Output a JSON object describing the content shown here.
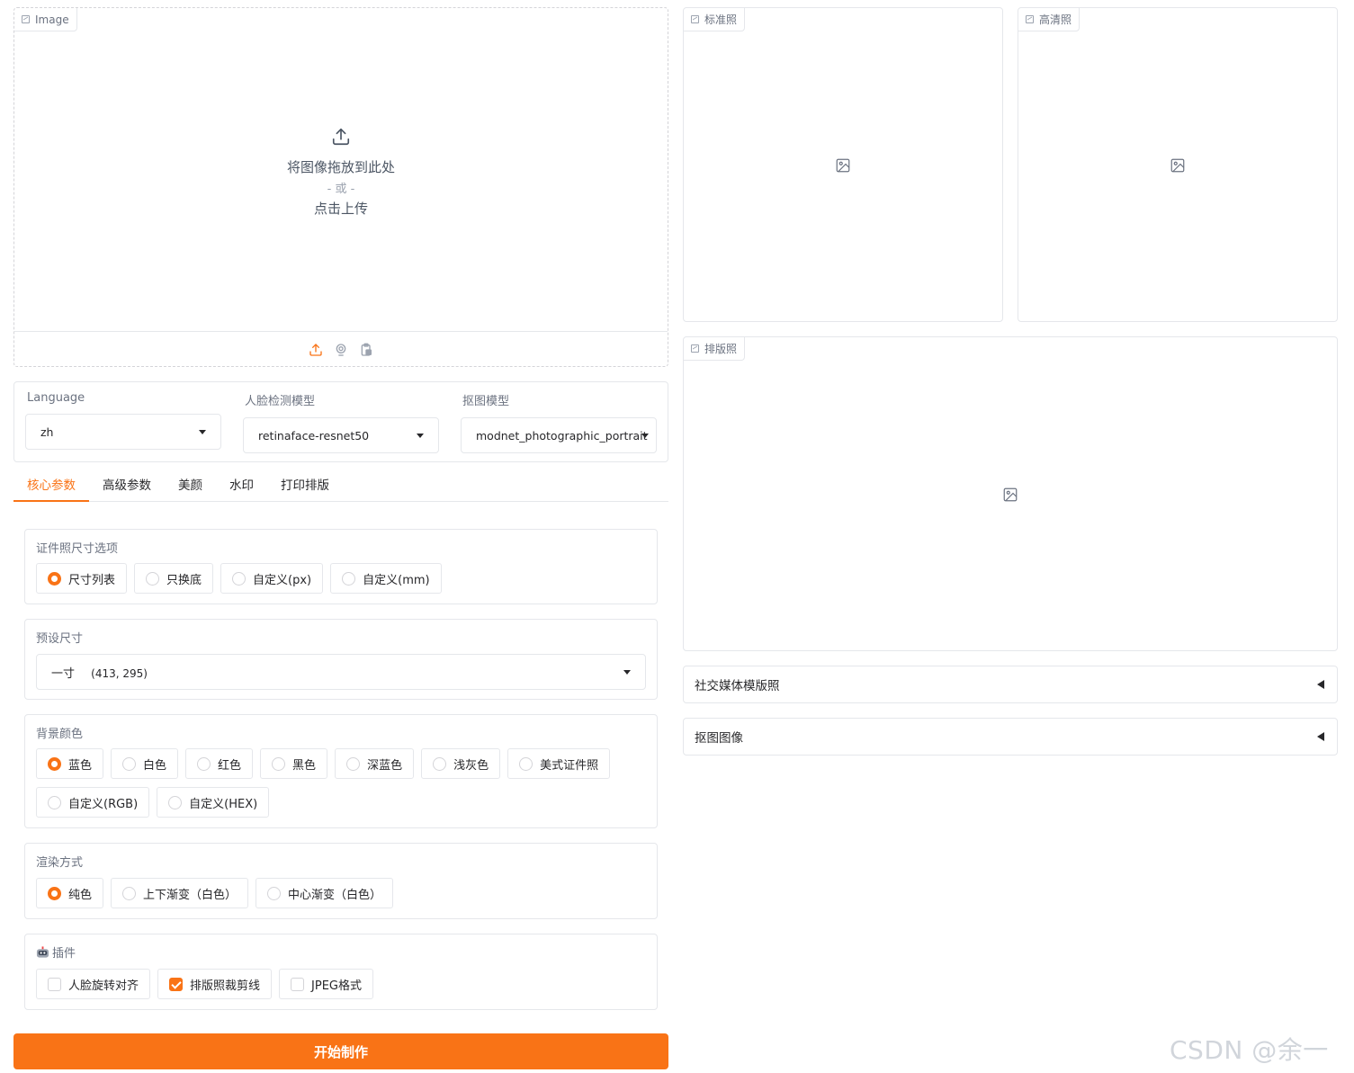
{
  "upload": {
    "tag": "Image",
    "drop_text": "将图像拖放到此处",
    "or_text": "- 或 -",
    "click_text": "点击上传"
  },
  "dropdowns": [
    {
      "label": "Language",
      "value": "zh"
    },
    {
      "label": "人脸检测模型",
      "value": "retinaface-resnet50"
    },
    {
      "label": "抠图模型",
      "value": "modnet_photographic_portrait"
    }
  ],
  "tabs": [
    "核心参数",
    "高级参数",
    "美颜",
    "水印",
    "打印排版"
  ],
  "size_options": {
    "label": "证件照尺寸选项",
    "options": [
      "尺寸列表",
      "只换底",
      "自定义(px)",
      "自定义(mm)"
    ],
    "selected": 0
  },
  "preset": {
    "label": "预设尺寸",
    "value_name": "一寸",
    "value_size": "(413, 295)"
  },
  "bg_color": {
    "label": "背景颜色",
    "options": [
      "蓝色",
      "白色",
      "红色",
      "黑色",
      "深蓝色",
      "浅灰色",
      "美式证件照",
      "自定义(RGB)",
      "自定义(HEX)"
    ],
    "selected": 0
  },
  "render": {
    "label": "渲染方式",
    "options": [
      "纯色",
      "上下渐变（白色）",
      "中心渐变（白色）"
    ],
    "selected": 0
  },
  "plugins": {
    "label": "插件",
    "options": [
      {
        "label": "人脸旋转对齐",
        "checked": false
      },
      {
        "label": "排版照裁剪线",
        "checked": true
      },
      {
        "label": "JPEG格式",
        "checked": false
      }
    ]
  },
  "start_button": "开始制作",
  "outputs": {
    "standard": "标准照",
    "hd": "高清照",
    "layout": "排版照"
  },
  "accordions": [
    "社交媒体模版照",
    "抠图图像"
  ],
  "watermark": "CSDN @余一笙",
  "colors": {
    "accent": "#f97316"
  }
}
